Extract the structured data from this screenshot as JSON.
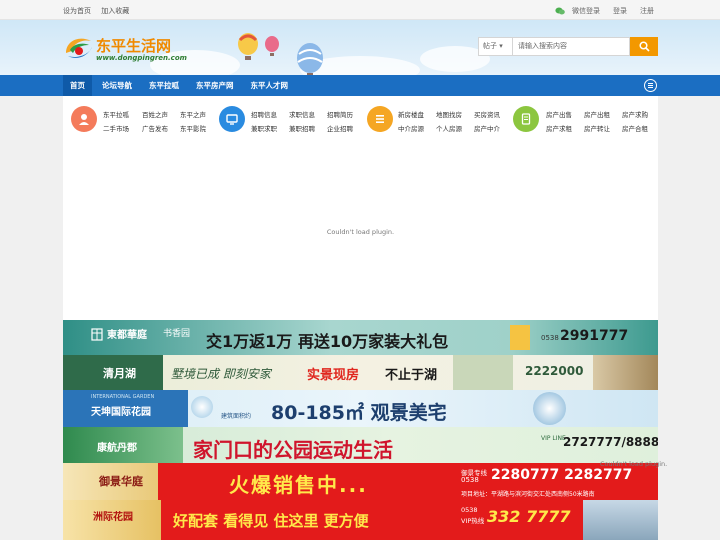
{
  "topbar": {
    "set_home": "设为首页",
    "add_favorite": "加入收藏",
    "wechat_login": "微信登录",
    "login": "登录",
    "register": "注册"
  },
  "header": {
    "logo_title": "东平生活网",
    "logo_url": "www.dongpingren.com",
    "search_type": "帖子",
    "search_placeholder": "请输入搜索内容"
  },
  "nav": {
    "items": [
      "首页",
      "论坛导航",
      "东平拉呱",
      "东平房产网",
      "东平人才网"
    ]
  },
  "quick": {
    "groups": [
      {
        "icon": "user-icon",
        "color": "#f47b5b",
        "links": [
          "东平拉呱",
          "二手市场",
          "百姓之声",
          "广告发布",
          "东平之声",
          "东平影院"
        ]
      },
      {
        "icon": "monitor-icon",
        "color": "#2a8be0",
        "links": [
          "招聘信息",
          "兼职求职",
          "求职信息",
          "兼职招聘",
          "招聘简历",
          "企业招聘"
        ]
      },
      {
        "icon": "list-icon",
        "color": "#f5a623",
        "links": [
          "新房楼盘",
          "中介房源",
          "地图找房",
          "个人房源",
          "买房资讯",
          "房产中介"
        ]
      },
      {
        "icon": "document-icon",
        "color": "#8cc63f",
        "links": [
          "房产出售",
          "房产求租",
          "房产出租",
          "房产转让",
          "房产求购",
          "房产合租"
        ]
      }
    ]
  },
  "plugin": {
    "message": "Couldn't load plugin."
  },
  "banners": [
    {
      "brand": "東都華庭",
      "brand2": "书香园",
      "headline": "交1万返1万  再送10万家装大礼包",
      "phone": "2991777",
      "area": "0538"
    },
    {
      "brand": "清月湖",
      "headline": "墅境已成 即刻安家",
      "highlight": "实景现房",
      "tagline": "不止于湖",
      "phone": "2222000"
    },
    {
      "brand": "天坤国际花园",
      "brand_en": "INTERNATIONAL GARDEN",
      "headline": "80-185㎡ 观景美宅",
      "sub": "建筑面积约"
    },
    {
      "brand": "康航丹郡",
      "headline": "家门口的公园运动生活",
      "phone": "2727777/8888",
      "vip": "VIP LINE"
    },
    {
      "brand": "御景华庭",
      "headline": "火爆销售中...",
      "phone_label": "御景专线",
      "phone": "2280777 2282777",
      "area": "0538",
      "address": "项目地址：平湖路与滨河街交汇处西南侧50米路南"
    },
    {
      "brand": "洲际花园",
      "headline": "好配套 看得见 住这里 更方便",
      "phone": "332 7777",
      "area": "0538",
      "hotline": "VIP热线"
    }
  ],
  "plugin2": {
    "message": "Couldn't load plugin."
  },
  "colors": {
    "nav_blue": "#1b6ec2",
    "accent_orange": "#f39800",
    "banner_red": "#e31b1b"
  }
}
